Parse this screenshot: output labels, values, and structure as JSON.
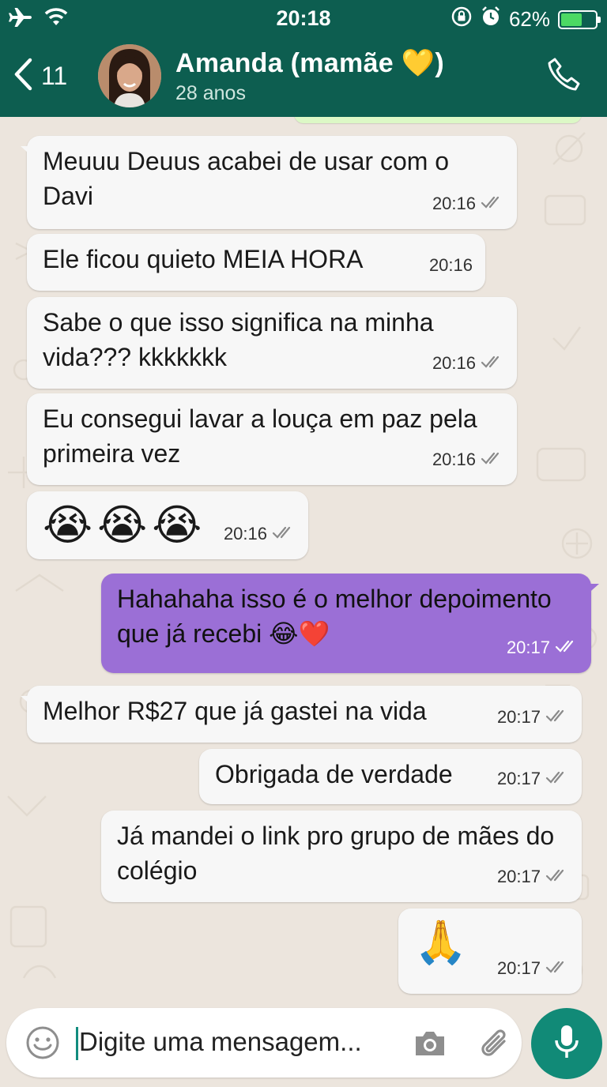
{
  "status_bar": {
    "time": "20:18",
    "battery_percent": "62%",
    "battery_level": 0.62
  },
  "header": {
    "back_count": "11",
    "contact_name": "Amanda (mamãe 💛)",
    "contact_subtitle": "28 anos"
  },
  "messages": [
    {
      "direction": "in",
      "text": "Meuuu Deuus acabei de usar com o Davi",
      "time": "20:16",
      "ticks": true
    },
    {
      "direction": "in",
      "text": "Ele ficou quieto MEIA HORA",
      "time": "20:16",
      "ticks": false
    },
    {
      "direction": "in",
      "text": "Sabe o que isso significa na minha vida???  kkkkkkk",
      "time": "20:16",
      "ticks": true
    },
    {
      "direction": "in",
      "text": "Eu consegui lavar a louça em paz pela primeira vez",
      "time": "20:16",
      "ticks": true
    },
    {
      "direction": "in",
      "text": "😭😭😭",
      "time": "20:16",
      "ticks": true
    },
    {
      "direction": "out",
      "text": "Hahahaha isso é o melhor depoimento que já recebi 😂❤️",
      "time": "20:17",
      "ticks": true
    },
    {
      "direction": "in",
      "text": "Melhor R$27 que já gastei na vida",
      "time": "20:17",
      "ticks": true
    },
    {
      "direction": "in",
      "text": "Obrigada de verdade",
      "time": "20:17",
      "ticks": true
    },
    {
      "direction": "in",
      "text": "Já mandei o link pro grupo de mães do colégio",
      "time": "20:17",
      "ticks": true
    },
    {
      "direction": "in",
      "text": "🙏",
      "time": "20:17",
      "ticks": true
    }
  ],
  "composer": {
    "placeholder": "Digite uma mensagem..."
  },
  "colors": {
    "header_bg": "#0d5e50",
    "incoming_bubble": "#f7f7f7",
    "outgoing_bubble": "#9b6fd6",
    "mic_button": "#118a77",
    "chat_bg": "#ece5dd"
  },
  "icons": [
    "airplane-icon",
    "wifi-icon",
    "rotation-lock-icon",
    "alarm-icon",
    "battery-icon",
    "back-chevron-icon",
    "phone-icon",
    "emoji-icon",
    "camera-icon",
    "paperclip-icon",
    "mic-icon",
    "double-check-icon"
  ]
}
